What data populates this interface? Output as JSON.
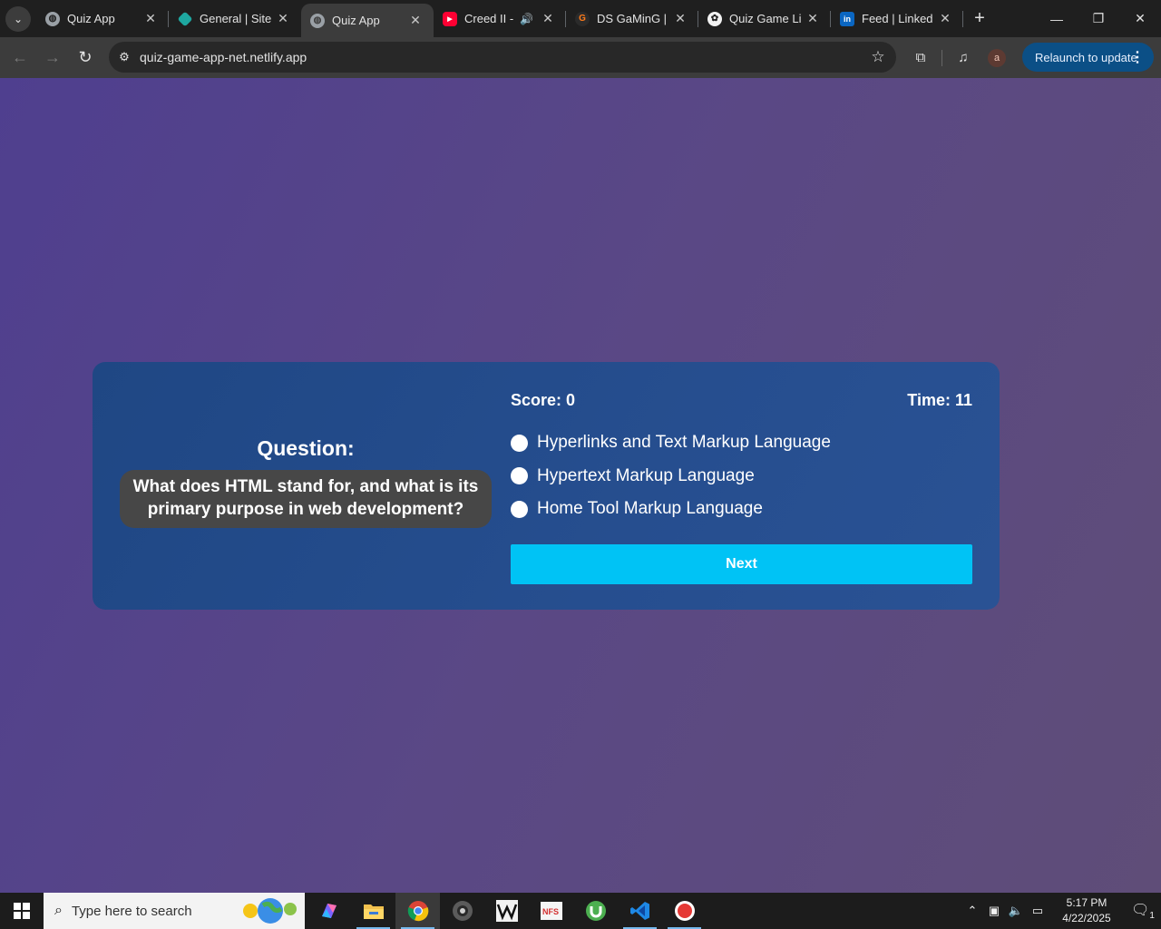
{
  "browser": {
    "tabs": [
      {
        "title": "Quiz App",
        "icon": "globe-icon",
        "active": false
      },
      {
        "title": "General | Site",
        "icon": "netlify-icon",
        "active": false
      },
      {
        "title": "Quiz App",
        "icon": "globe-icon",
        "active": true
      },
      {
        "title": "Creed II -",
        "icon": "youtube-icon",
        "active": false
      },
      {
        "title": "DS GaMinG |",
        "icon": "game-icon",
        "active": false
      },
      {
        "title": "Quiz Game Li",
        "icon": "chatgpt-icon",
        "active": false
      },
      {
        "title": "Feed | Linked",
        "icon": "linkedin-icon",
        "active": false
      }
    ],
    "url": "quiz-game-app-net.netlify.app",
    "relaunch_label": "Relaunch to update",
    "avatar_letter": "a"
  },
  "quiz": {
    "question_heading": "Question:",
    "question_text": "What does HTML stand for, and what is its primary purpose in web development?",
    "score_label": "Score: 0",
    "time_label": "Time: 11",
    "options": [
      "Hyperlinks and Text Markup Language",
      "Hypertext Markup Language",
      "Home Tool Markup Language"
    ],
    "next_label": "Next"
  },
  "colors": {
    "next_button": "#00c3f5",
    "card": "#24498a",
    "question_box": "#474747"
  },
  "taskbar": {
    "search_placeholder": "Type here to search",
    "time": "5:17 PM",
    "date": "4/22/2025",
    "notification_count": "1"
  }
}
